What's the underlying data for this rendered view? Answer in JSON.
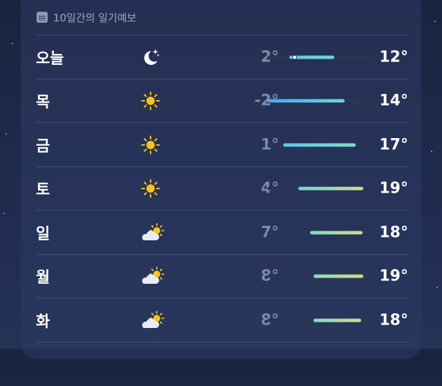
{
  "header": {
    "title": "10일간의 일기예보",
    "icon": "calendar-icon"
  },
  "forecast": [
    {
      "day": "오늘",
      "icon": "moon-stars-icon",
      "low": "2°",
      "high": "12°",
      "bar_start": 0.22,
      "bar_end": 0.67,
      "current": 0.27,
      "gradient": [
        "#5ec8e6",
        "#6fd3d8"
      ]
    },
    {
      "day": "목",
      "icon": "sun-icon",
      "low": "-2°",
      "high": "14°",
      "bar_start": 0.0,
      "bar_end": 0.77,
      "current": null,
      "gradient": [
        "#4aa9ee",
        "#6fd6dc"
      ]
    },
    {
      "day": "금",
      "icon": "sun-icon",
      "low": "1°",
      "high": "17°",
      "bar_start": 0.16,
      "bar_end": 0.88,
      "current": null,
      "gradient": [
        "#5ec8e6",
        "#7edcc8"
      ]
    },
    {
      "day": "토",
      "icon": "sun-icon",
      "low": "4°",
      "high": "19°",
      "bar_start": 0.31,
      "bar_end": 0.96,
      "current": null,
      "gradient": [
        "#6fd6d6",
        "#cfdc82"
      ]
    },
    {
      "day": "일",
      "icon": "partly-cloudy-icon",
      "low": "7°",
      "high": "18°",
      "bar_start": 0.43,
      "bar_end": 0.95,
      "current": null,
      "gradient": [
        "#7fddc4",
        "#cfdc82"
      ]
    },
    {
      "day": "월",
      "icon": "partly-cloudy-icon",
      "low": "8°",
      "high": "19°",
      "bar_start": 0.46,
      "bar_end": 0.96,
      "current": null,
      "gradient": [
        "#86dec0",
        "#d2dc7e"
      ]
    },
    {
      "day": "화",
      "icon": "partly-cloudy-icon",
      "low": "8°",
      "high": "18°",
      "bar_start": 0.46,
      "bar_end": 0.94,
      "current": null,
      "gradient": [
        "#86dec0",
        "#cfdc82"
      ]
    }
  ],
  "colors": {
    "sun": "#f9c51c",
    "cloud": "#e9ecf4",
    "moon": "#ffffff"
  }
}
